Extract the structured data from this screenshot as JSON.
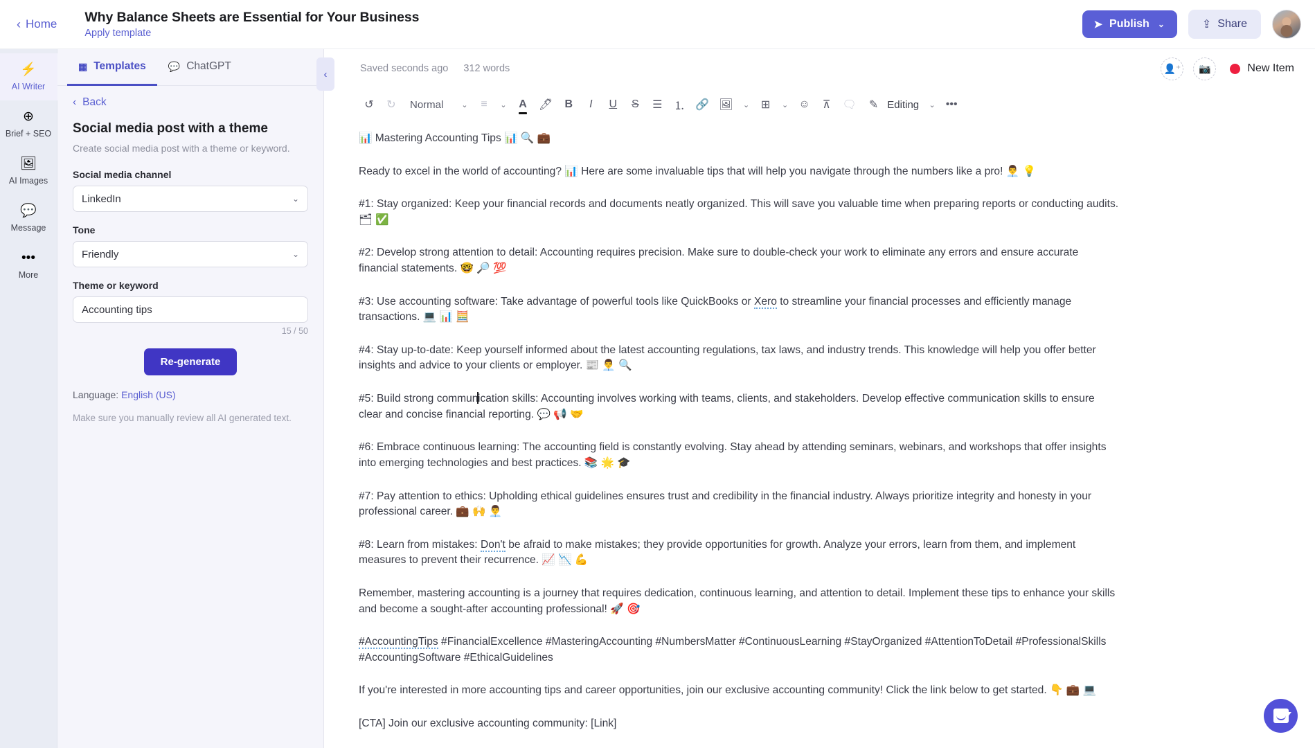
{
  "topbar": {
    "home_label": "Home",
    "doc_title": "Why Balance Sheets are Essential for Your Business",
    "apply_template": "Apply template",
    "publish_label": "Publish",
    "share_label": "Share"
  },
  "rail": {
    "items": [
      {
        "icon": "⚡",
        "label": "AI Writer"
      },
      {
        "icon": "⊕",
        "label": "Brief + SEO"
      },
      {
        "icon": "🖼",
        "label": "AI Images"
      },
      {
        "icon": "💬",
        "label": "Message"
      },
      {
        "icon": "•••",
        "label": "More"
      }
    ]
  },
  "panel": {
    "tabs": [
      {
        "icon": "▦",
        "label": "Templates"
      },
      {
        "icon": "💬",
        "label": "ChatGPT"
      }
    ],
    "back_label": "Back",
    "template_title": "Social media post with a theme",
    "template_desc": "Create social media post with a theme or keyword.",
    "fields": {
      "channel_label": "Social media channel",
      "channel_value": "LinkedIn",
      "tone_label": "Tone",
      "tone_value": "Friendly",
      "keyword_label": "Theme or keyword",
      "keyword_value": "Accounting tips",
      "keyword_counter": "15 / 50"
    },
    "regenerate_label": "Re-generate",
    "language_prefix": "Language:",
    "language_value": "English (US)",
    "disclaimer": "Make sure you manually review all AI generated text."
  },
  "editor": {
    "saved_text": "Saved seconds ago",
    "word_count": "312 words",
    "new_item_label": "New Item",
    "toolbar": {
      "undo": "↺",
      "redo": "↻",
      "style_value": "Normal",
      "align": "≡",
      "font_color": "A",
      "highlight": "🖊",
      "bold": "B",
      "italic": "I",
      "underline": "U",
      "strikethrough": "S",
      "bullet_list": "☰",
      "numbered_list": "⒈",
      "link": "🔗",
      "image": "🖼",
      "table": "⊞",
      "emoji": "☺",
      "clear_format": "⊼",
      "comment": "🗨",
      "mode_icon": "✎",
      "mode_label": "Editing",
      "more": "•••"
    }
  },
  "document": {
    "paragraphs": [
      {
        "id": "heading",
        "text": "📊 Mastering Accounting Tips 📊 🔍 💼"
      },
      {
        "id": "intro",
        "text": "Ready to excel in the world of accounting? 📊 Here are some invaluable tips that will help you navigate through the numbers like a pro! 👨‍💼 💡"
      },
      {
        "id": "tip-1",
        "text": "#1: Stay organized: Keep your financial records and documents neatly organized. This will save you valuable time when preparing reports or conducting audits. 🗂 ✅"
      },
      {
        "id": "tip-2",
        "text": "#2: Develop strong attention to detail: Accounting requires precision. Make sure to double-check your work to eliminate any errors and ensure accurate financial statements. 🤓 🔎 💯"
      },
      {
        "id": "tip-3",
        "text": "#3: Use accounting software: Take advantage of powerful tools like QuickBooks or Xero to streamline your financial processes and efficiently manage transactions. 💻 📊 🧮",
        "spell_word": "Xero"
      },
      {
        "id": "tip-4",
        "text": "#4: Stay up-to-date: Keep yourself informed about the latest accounting regulations, tax laws, and industry trends. This knowledge will help you offer better insights and advice to your clients or employer. 📰 👨‍💼 🔍"
      },
      {
        "id": "tip-5",
        "text": "#5: Build strong communication skills: Accounting involves working with teams, clients, and stakeholders. Develop effective communication skills to ensure clear and concise financial reporting. 💬 📢 🤝",
        "caret_after": "commun"
      },
      {
        "id": "tip-6",
        "text": "#6: Embrace continuous learning: The accounting field is constantly evolving. Stay ahead by attending seminars, webinars, and workshops that offer insights into emerging technologies and best practices. 📚 🌟 🎓"
      },
      {
        "id": "tip-7",
        "text": "#7: Pay attention to ethics: Upholding ethical guidelines ensures trust and credibility in the financial industry. Always prioritize integrity and honesty in your professional career. 💼 🙌 👨‍💼"
      },
      {
        "id": "tip-8",
        "text": "#8: Learn from mistakes: Don't be afraid to make mistakes; they provide opportunities for growth. Analyze your errors, learn from them, and implement measures to prevent their recurrence. 📈 📉 💪",
        "spell_word": "Don't"
      },
      {
        "id": "closing",
        "text": "Remember, mastering accounting is a journey that requires dedication, continuous learning, and attention to detail. Implement these tips to enhance your skills and become a sought-after accounting professional! 🚀 🎯"
      },
      {
        "id": "hashtags",
        "text": "#AccountingTips #FinancialExcellence #MasteringAccounting #NumbersMatter #ContinuousLearning #StayOrganized #AttentionToDetail #ProfessionalSkills #AccountingSoftware #EthicalGuidelines",
        "spell_word": "#AccountingTips"
      },
      {
        "id": "community",
        "text": "If you're interested in more accounting tips and career opportunities, join our exclusive accounting community! Click the link below to get started. 👇 💼 💻"
      },
      {
        "id": "cta",
        "text": "[CTA] Join our exclusive accounting community: [Link]"
      }
    ]
  },
  "colors": {
    "accent": "#5a5fd6",
    "accent_deep": "#4036c4",
    "rail_bg": "#e9ecf4",
    "panel_bg": "#f5f5fb",
    "new_item_dot": "#ee1f3f"
  }
}
